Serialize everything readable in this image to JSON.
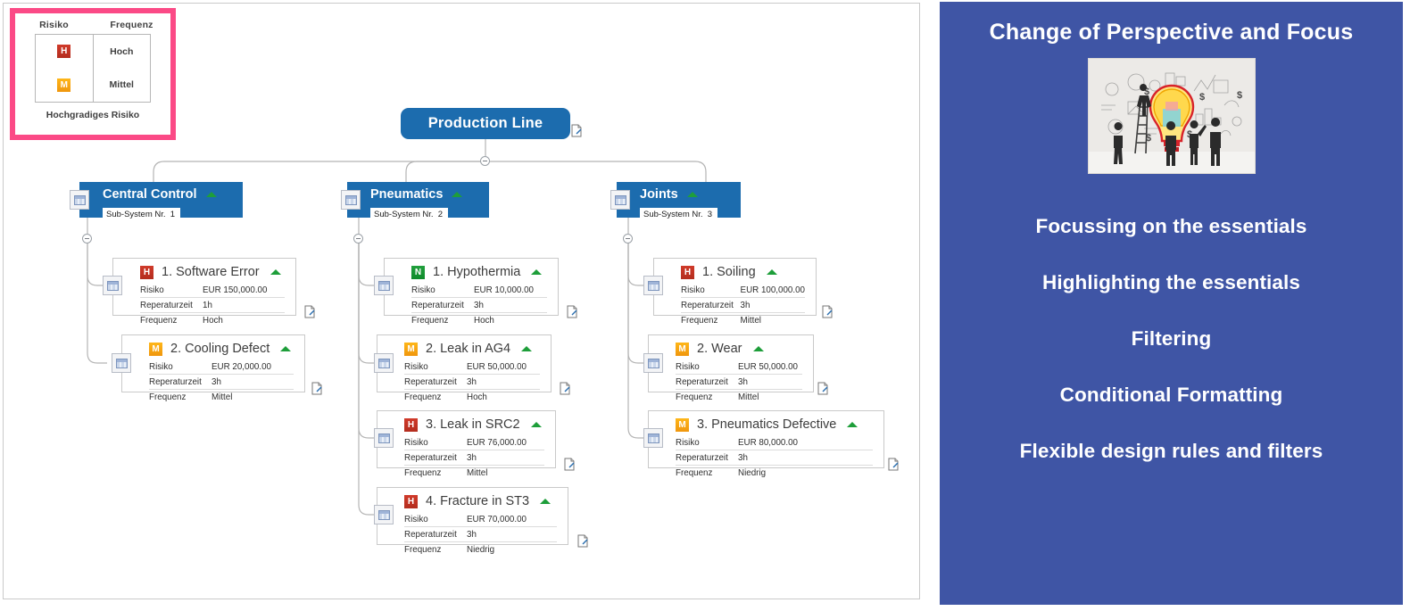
{
  "legend": {
    "headers": [
      "Risiko",
      "Frequenz"
    ],
    "rows": [
      {
        "badge": "H",
        "badge_color": "#c0392b",
        "frequency": "Hoch"
      },
      {
        "badge": "M",
        "badge_color": "#f5a623",
        "frequency": "Mittel"
      }
    ],
    "footer": "Hochgradiges Risiko",
    "highlight_color": "#fb4a86"
  },
  "diagram": {
    "root": {
      "label": "Production Line",
      "color": "#1c6cae"
    },
    "table_labels": {
      "risiko": "Risiko",
      "reperaturzeit": "Reperaturzeit",
      "frequenz": "Frequenz"
    },
    "subsystems": [
      {
        "title": "Central Control",
        "tag": "Sub-System Nr.  1",
        "children": [
          {
            "badge": "H",
            "title": "1. Software Error",
            "risiko": "EUR 150,000.00",
            "reperaturzeit": "1h",
            "frequenz": "Hoch"
          },
          {
            "badge": "M",
            "title": "2. Cooling Defect",
            "risiko": "EUR 20,000.00",
            "reperaturzeit": "3h",
            "frequenz": "Mittel"
          }
        ]
      },
      {
        "title": "Pneumatics",
        "tag": "Sub-System Nr.  2",
        "children": [
          {
            "badge": "N",
            "title": "1. Hypothermia",
            "risiko": "EUR 10,000.00",
            "reperaturzeit": "3h",
            "frequenz": "Hoch"
          },
          {
            "badge": "M",
            "title": "2. Leak in AG4",
            "risiko": "EUR 50,000.00",
            "reperaturzeit": "3h",
            "frequenz": "Hoch"
          },
          {
            "badge": "H",
            "title": "3. Leak in SRC2",
            "risiko": "EUR 76,000.00",
            "reperaturzeit": "3h",
            "frequenz": "Mittel"
          },
          {
            "badge": "H",
            "title": "4. Fracture in ST3",
            "risiko": "EUR 70,000.00",
            "reperaturzeit": "3h",
            "frequenz": "Niedrig"
          }
        ]
      },
      {
        "title": "Joints",
        "tag": "Sub-System Nr.  3",
        "children": [
          {
            "badge": "H",
            "title": "1. Soiling",
            "risiko": "EUR 100,000.00",
            "reperaturzeit": "3h",
            "frequenz": "Mittel"
          },
          {
            "badge": "M",
            "title": "2. Wear",
            "risiko": "EUR 50,000.00",
            "reperaturzeit": "3h",
            "frequenz": "Mittel"
          },
          {
            "badge": "M",
            "title": "3. Pneumatics Defective",
            "risiko": "EUR 80,000.00",
            "reperaturzeit": "3h",
            "frequenz": "Niedrig"
          }
        ]
      }
    ]
  },
  "panel": {
    "title": "Change of Perspective and Focus",
    "image_alt": "people-drawing-lightbulb-ideas-illustration",
    "background_color": "#3f55a5",
    "lines": [
      "Focussing on the essentials",
      "Highlighting the essentials",
      "Filtering",
      "Conditional Formatting",
      "Flexible design rules and filters"
    ]
  }
}
